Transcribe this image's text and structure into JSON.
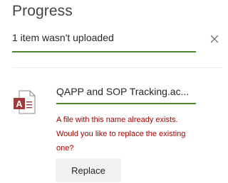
{
  "panel": {
    "title": "Progress",
    "summary": "1 item wasn't uploaded",
    "progress_color": "#4e8a2e"
  },
  "file": {
    "name": "QAPP and SOP Tracking.ac...",
    "icon": "access-file-icon",
    "error": "A file with this name already exists. Would you like to replace the existing one?",
    "error_color": "#a80000"
  },
  "actions": {
    "replace_label": "Replace",
    "close_icon": "close-icon"
  }
}
